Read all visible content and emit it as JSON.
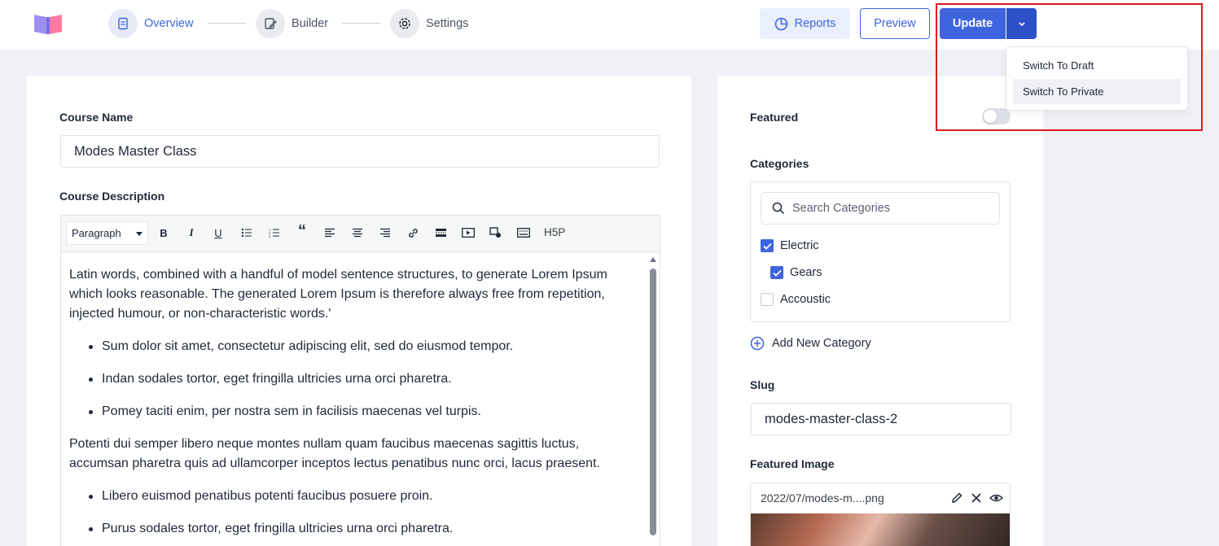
{
  "header": {
    "steps": [
      {
        "label": "Overview",
        "icon": "document-icon",
        "active": true
      },
      {
        "label": "Builder",
        "icon": "edit-icon",
        "active": false
      },
      {
        "label": "Settings",
        "icon": "gear-icon",
        "active": false
      }
    ],
    "reports_label": "Reports",
    "preview_label": "Preview",
    "update_label": "Update",
    "dropdown": {
      "items": [
        "Switch To Draft",
        "Switch To Private"
      ],
      "hovered_index": 1
    }
  },
  "course": {
    "name_label": "Course Name",
    "name_value": "Modes Master Class",
    "description_label": "Course Description",
    "toolbar": {
      "format_select": "Paragraph",
      "icons": [
        "bold-icon",
        "italic-icon",
        "underline-icon",
        "bullet-list-icon",
        "numbered-list-icon",
        "blockquote-icon",
        "align-left-icon",
        "align-center-icon",
        "align-right-icon",
        "link-icon",
        "read-more-icon",
        "video-icon",
        "media-icon",
        "keyboard-icon"
      ],
      "h5p_label": "H5P"
    },
    "content": {
      "p1": "Latin words, combined with a handful of model sentence structures, to generate Lorem Ipsum which looks reasonable. The generated Lorem Ipsum is therefore always free from repetition, injected humour, or non-characteristic words.'",
      "list1": [
        "Sum dolor sit amet, consectetur adipiscing elit, sed do eiusmod tempor.",
        "Indan sodales tortor, eget fringilla ultricies urna orci pharetra.",
        "Pomey taciti enim, per nostra sem in facilisis maecenas vel turpis."
      ],
      "p2": "Potenti dui semper libero neque montes nullam quam faucibus maecenas sagittis luctus, accumsan pharetra quis ad ullamcorper inceptos lectus penatibus nunc orci, lacus praesent.",
      "list2": [
        "Libero euismod penatibus potenti faucibus posuere proin.",
        "Purus sodales tortor, eget fringilla ultricies urna orci pharetra."
      ]
    }
  },
  "sidebar": {
    "featured_label": "Featured",
    "featured_on": false,
    "categories_label": "Categories",
    "search_placeholder": "Search Categories",
    "categories": [
      {
        "label": "Electric",
        "checked": true,
        "level": 0
      },
      {
        "label": "Gears",
        "checked": true,
        "level": 1
      },
      {
        "label": "Accoustic",
        "checked": false,
        "level": 0
      }
    ],
    "add_category_label": "Add New Category",
    "slug_label": "Slug",
    "slug_value": "modes-master-class-2",
    "featured_image_label": "Featured Image",
    "featured_image_name": "2022/07/modes-m....png"
  },
  "colors": {
    "accent": "#3e64de",
    "highlight_border": "#e0191f"
  }
}
